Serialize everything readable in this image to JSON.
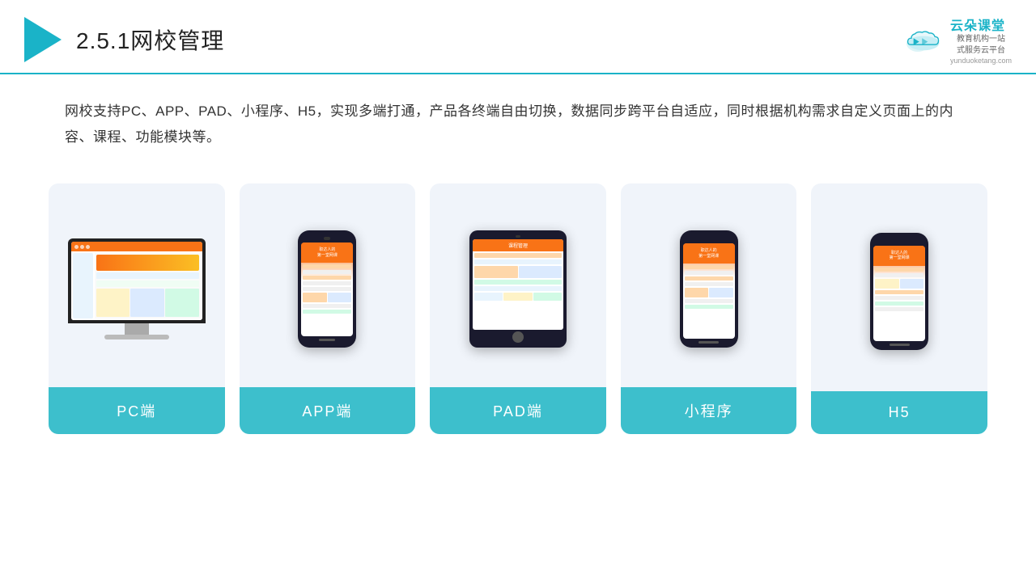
{
  "header": {
    "title_num": "2.5.1",
    "title_text": "网校管理",
    "brand_name": "云朵课堂",
    "brand_sub_line1": "教育机构一站",
    "brand_sub_line2": "式服务云平台",
    "brand_url": "yunduoketang.com"
  },
  "description": {
    "text": "网校支持PC、APP、PAD、小程序、H5，实现多端打通，产品各终端自由切换，数据同步跨平台自适应，同时根据机构需求自定义页面上的内容、课程、功能模块等。"
  },
  "cards": [
    {
      "id": "pc",
      "label": "PC端"
    },
    {
      "id": "app",
      "label": "APP端"
    },
    {
      "id": "pad",
      "label": "PAD端"
    },
    {
      "id": "mini",
      "label": "小程序"
    },
    {
      "id": "h5",
      "label": "H5"
    }
  ]
}
